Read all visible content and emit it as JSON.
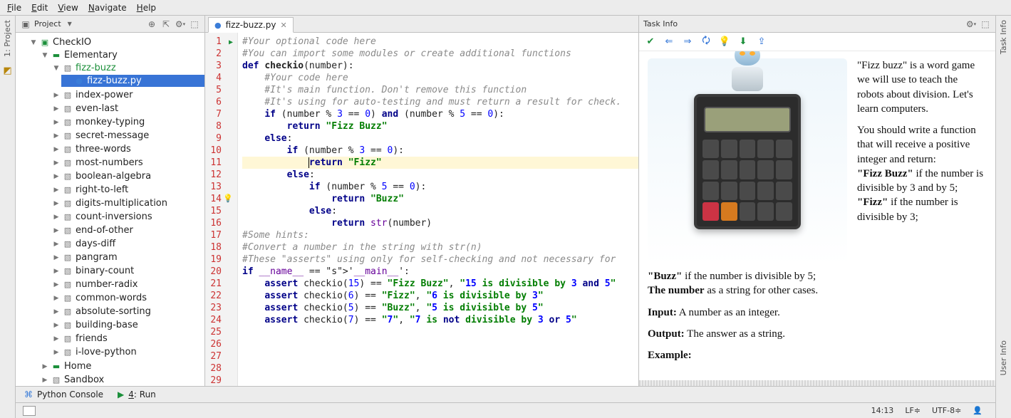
{
  "menu": {
    "file": "File",
    "edit": "Edit",
    "view": "View",
    "navigate": "Navigate",
    "help": "Help"
  },
  "leftstrip": {
    "project": "1: Project"
  },
  "rightstrip": {
    "taskinfo": "Task Info",
    "userinfo": "User Info"
  },
  "project_panel": {
    "title": "Project",
    "tree": {
      "root": "CheckIO",
      "elementary": "Elementary",
      "fizzbuzz_dir": "fizz-buzz",
      "fizzbuzz_file": "fizz-buzz.py",
      "items": [
        "index-power",
        "even-last",
        "monkey-typing",
        "secret-message",
        "three-words",
        "most-numbers",
        "boolean-algebra",
        "right-to-left",
        "digits-multiplication",
        "count-inversions",
        "end-of-other",
        "days-diff",
        "pangram",
        "binary-count",
        "number-radix",
        "common-words",
        "absolute-sorting",
        "building-base",
        "friends",
        "i-love-python"
      ],
      "home": "Home",
      "sandbox": "Sandbox"
    }
  },
  "editor": {
    "tab_label": "fizz-buzz.py",
    "lines": [
      "#Your optional code here",
      "#You can import some modules or create additional functions",
      "",
      "",
      "def checkio(number):",
      "    #Your code here",
      "    #It's main function. Don't remove this function",
      "    #It's using for auto-testing and must return a result for check.",
      "",
      "    if (number % 3 == 0) and (number % 5 == 0):",
      "        return \"Fizz Buzz\"",
      "    else:",
      "        if (number % 3 == 0):",
      "            return \"Fizz\"",
      "        else:",
      "            if (number % 5 == 0):",
      "                return \"Buzz\"",
      "            else:",
      "                return str(number)",
      "",
      "#Some hints:",
      "#Convert a number in the string with str(n)",
      "",
      "#These \"asserts\" using only for self-checking and not necessary for ",
      "if __name__ == '__main__':",
      "    assert checkio(15) == \"Fizz Buzz\", \"15 is divisible by 3 and 5\"",
      "    assert checkio(6) == \"Fizz\", \"6 is divisible by 3\"",
      "    assert checkio(5) == \"Buzz\", \"5 is divisible by 5\"",
      "    assert checkio(7) == \"7\", \"7 is not divisible by 3 or 5\""
    ]
  },
  "task": {
    "title": "Task Info",
    "p1a": "\"Fizz buzz\" is a word game we will use to teach the robots about division. Let's learn computers.",
    "p2": "You should write a function that will receive a positive integer and return:",
    "b_fb": "\"Fizz Buzz\"",
    "b_fb_t": " if the number is divisible by 3 and by 5;",
    "b_f": "\"Fizz\"",
    "b_f_t": " if the number is divisible by 3;",
    "b_b": "\"Buzz\"",
    "b_b_t": " if the number is divisible by 5;",
    "b_n": "The number",
    "b_n_t": " as a string for other cases.",
    "input_l": "Input:",
    "input_v": " A number as an integer.",
    "output_l": "Output:",
    "output_v": " The answer as a string.",
    "example_l": "Example:"
  },
  "bottom": {
    "console": "Python Console",
    "run": "4: Run"
  },
  "status": {
    "pos": "14:13",
    "le": "LF",
    "enc": "UTF-8"
  }
}
